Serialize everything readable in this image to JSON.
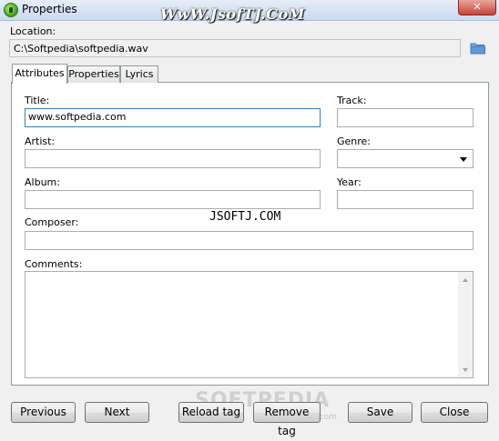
{
  "window": {
    "title": "Properties",
    "close_label": "✕"
  },
  "watermarks": {
    "top": "WwW.JsofTJ.CoM",
    "middle": "JSOFTJ.COM",
    "bottom": "SOFTPEDIA",
    "bottom_small": "www.softpedia.com"
  },
  "location": {
    "label": "Location:",
    "value": "C:\\Softpedia\\softpedia.wav"
  },
  "tabs": [
    {
      "label": "Attributes",
      "active": true
    },
    {
      "label": "Properties",
      "active": false
    },
    {
      "label": "Lyrics",
      "active": false
    }
  ],
  "form": {
    "title_label": "Title:",
    "title_value": "www.softpedia.com",
    "track_label": "Track:",
    "track_value": "",
    "artist_label": "Artist:",
    "artist_value": "",
    "genre_label": "Genre:",
    "genre_value": "",
    "album_label": "Album:",
    "album_value": "",
    "year_label": "Year:",
    "year_value": "",
    "composer_label": "Composer:",
    "composer_value": "",
    "comments_label": "Comments:",
    "comments_value": ""
  },
  "buttons": {
    "previous": "Previous",
    "next": "Next",
    "reload_tag": "Reload tag",
    "remove_tag": "Remove tag",
    "save": "Save",
    "close": "Close"
  },
  "colors": {
    "window_bg": "#f0f0f0",
    "focus_border": "#3c7fb1",
    "close_button": "#c7443a"
  }
}
